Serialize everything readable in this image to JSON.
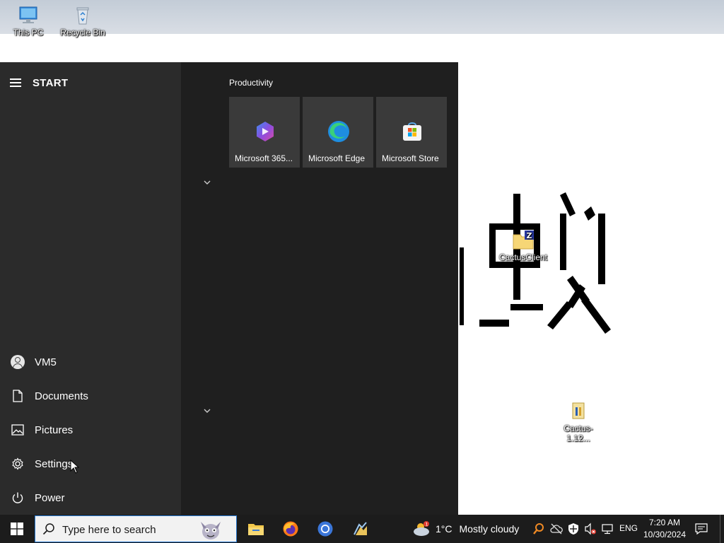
{
  "desktop": {
    "icons": [
      {
        "label": "This PC",
        "icon": "computer-icon"
      },
      {
        "label": "Recycle Bin",
        "icon": "recycle-bin-icon"
      },
      {
        "label": "CactusClient",
        "icon": "folder-zip-icon"
      },
      {
        "label": "Cactus-1.12...",
        "icon": "installer-icon"
      }
    ]
  },
  "start_menu": {
    "title": "START",
    "group_title": "Productivity",
    "tiles": [
      {
        "label": "Microsoft 365...",
        "icon": "microsoft-365-icon"
      },
      {
        "label": "Microsoft Edge",
        "icon": "edge-icon"
      },
      {
        "label": "Microsoft Store",
        "icon": "store-icon"
      }
    ],
    "side_items": [
      {
        "label": "VM5",
        "icon": "user-avatar-icon"
      },
      {
        "label": "Documents",
        "icon": "document-icon"
      },
      {
        "label": "Pictures",
        "icon": "pictures-icon"
      },
      {
        "label": "Settings",
        "icon": "gear-icon"
      },
      {
        "label": "Power",
        "icon": "power-icon"
      }
    ]
  },
  "taskbar": {
    "search_placeholder": "Type here to search",
    "apps": [
      "file-explorer-icon",
      "firefox-icon",
      "chrome-icon",
      "app-icon"
    ],
    "weather": {
      "temp": "1°C",
      "condition": "Mostly cloudy",
      "badge": "1"
    },
    "language": "ENG",
    "time": "7:20 AM",
    "date": "10/30/2024"
  },
  "colors": {
    "start_bg": "#1f1f1f",
    "start_left_bg": "#2b2b2b",
    "tile_bg": "#3a3a3a",
    "taskbar_bg": "#1c1c1c",
    "search_border": "#2a7bd3"
  }
}
